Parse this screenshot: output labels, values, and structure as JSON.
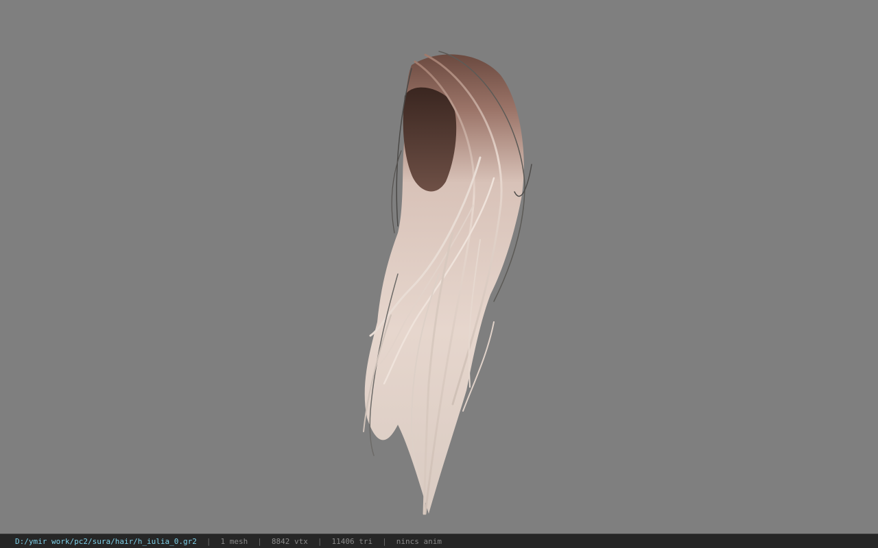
{
  "viewer": {
    "background": "#7f7f7f",
    "model_icon": "hair-model-icon"
  },
  "statusbar": {
    "file_path": "D:/ymir work/pc2/sura/hair/h_iulia_0.gr2",
    "mesh_count": "1 mesh",
    "vertex_count": "8842 vtx",
    "triangle_count": "11406 tri",
    "anim_status": "nincs anim",
    "separator": "|",
    "path_color": "#7fd0e8",
    "text_color": "#8a8a8a"
  }
}
